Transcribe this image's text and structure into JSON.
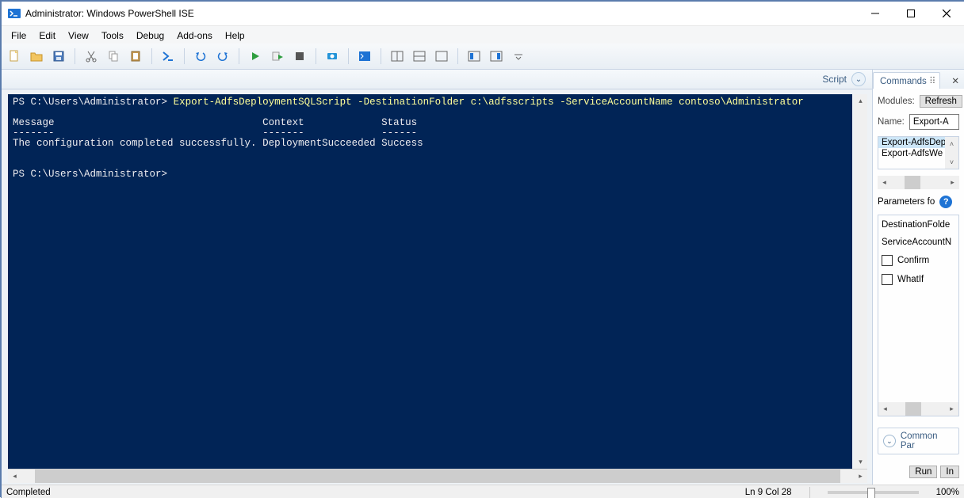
{
  "window": {
    "title": "Administrator: Windows PowerShell ISE"
  },
  "menu": {
    "items": [
      "File",
      "Edit",
      "View",
      "Tools",
      "Debug",
      "Add-ons",
      "Help"
    ]
  },
  "editor": {
    "script_label": "Script"
  },
  "console": {
    "prompt1": "PS C:\\Users\\Administrator>",
    "command": "Export-AdfsDeploymentSQLScript -DestinationFolder c:\\adfsscripts -ServiceAccountName contoso\\Administrator",
    "header_message": "Message",
    "header_context": "Context",
    "header_status": "Status",
    "rule_message": "-------",
    "rule_context": "-------",
    "rule_status": "------",
    "row_message": "The configuration completed successfully.",
    "row_context": "DeploymentSucceeded",
    "row_status": "Success",
    "prompt2": "PS C:\\Users\\Administrator>"
  },
  "commands": {
    "tab_label": "Commands",
    "modules_label": "Modules:",
    "refresh_label": "Refresh",
    "name_label": "Name:",
    "name_value": "Export-A",
    "list": [
      "Export-AdfsDep",
      "Export-AdfsWe"
    ],
    "parameters_label": "Parameters fo",
    "params": {
      "destination": "DestinationFolde",
      "service_account": "ServiceAccountN",
      "confirm": "Confirm",
      "whatif": "WhatIf"
    },
    "common_params_label": "Common Par",
    "run_label": "Run",
    "insert_label": "In"
  },
  "status": {
    "completed": "Completed",
    "ln_col": "Ln 9  Col 28",
    "zoom": "100%"
  },
  "glyphs": {
    "min": "—",
    "max": "▢",
    "close": "✕",
    "chev_down": "⌄",
    "chev_up": "˄",
    "left": "◂",
    "right": "▸"
  }
}
